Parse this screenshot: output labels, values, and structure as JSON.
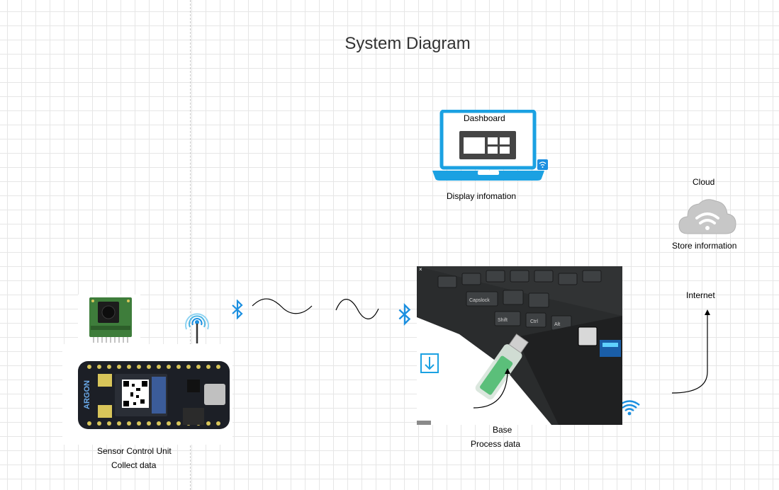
{
  "title": "System Diagram",
  "dashboard": {
    "title": "Dashboard",
    "caption": "Display infomation"
  },
  "cloud": {
    "title": "Cloud",
    "caption": "Store information"
  },
  "internet": {
    "label": "Internet"
  },
  "base": {
    "title": "Base",
    "caption": "Process data"
  },
  "sensor_unit": {
    "title": "Sensor Control Unit",
    "caption": "Collect data",
    "board_text": "ARGON"
  },
  "laptop_keys": [
    "Capslock",
    "Shift",
    "Ctrl",
    "Alt"
  ],
  "colors": {
    "accent_blue": "#1ba1e2",
    "bluetooth_blue": "#1b8fe0",
    "cloud_grey": "#c7c7c7",
    "board_black": "#1c1f26"
  }
}
